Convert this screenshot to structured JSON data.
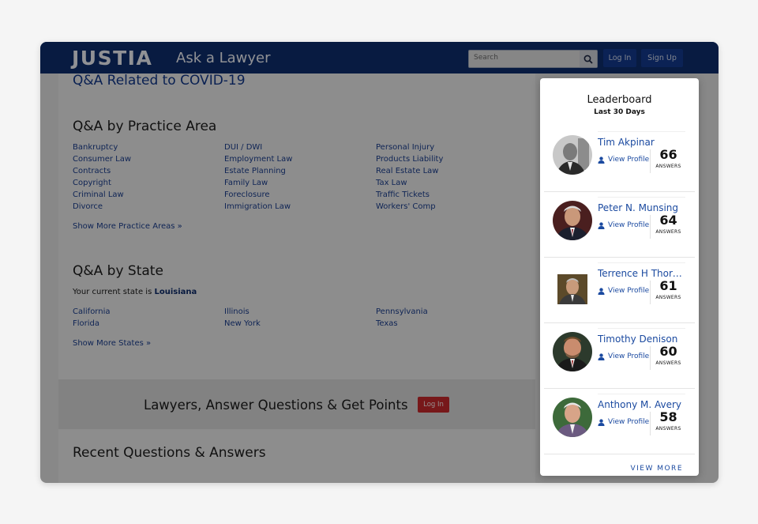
{
  "header": {
    "logo": "JUSTIA",
    "tagline": "Ask a Lawyer",
    "search_placeholder": "Search",
    "login_label": "Log In",
    "signup_label": "Sign Up"
  },
  "covid_link": "Q&A Related to COVID-19",
  "practice": {
    "heading": "Q&A by Practice Area",
    "col1": [
      "Bankruptcy",
      "Consumer Law",
      "Contracts",
      "Copyright",
      "Criminal Law",
      "Divorce"
    ],
    "col2": [
      "DUI / DWI",
      "Employment Law",
      "Estate Planning",
      "Family Law",
      "Foreclosure",
      "Immigration Law"
    ],
    "col3": [
      "Personal Injury",
      "Products Liability",
      "Real Estate Law",
      "Tax Law",
      "Traffic Tickets",
      "Workers' Comp"
    ],
    "show_more": "Show More Practice Areas »"
  },
  "state": {
    "heading": "Q&A by State",
    "current_prefix": "Your current state is",
    "current_state": "Louisiana",
    "col1": [
      "California",
      "Florida"
    ],
    "col2": [
      "Illinois",
      "New York"
    ],
    "col3": [
      "Pennsylvania",
      "Texas"
    ],
    "show_more": "Show More States »"
  },
  "promo": {
    "text": "Lawyers, Answer Questions & Get Points",
    "button": "Log In"
  },
  "recent_heading": "Recent Questions & Answers",
  "leaderboard": {
    "title": "Leaderboard",
    "subtitle": "Last 30 Days",
    "view_profile": "View Profile",
    "answers_label": "ANSWERS",
    "entries": [
      {
        "name": "Tim Akpinar",
        "count": "66"
      },
      {
        "name": "Peter N. Munsing",
        "count": "64"
      },
      {
        "name": "Terrence H Thorgaard",
        "count": "61"
      },
      {
        "name": "Timothy Denison",
        "count": "60"
      },
      {
        "name": "Anthony M. Avery",
        "count": "58"
      }
    ],
    "view_more": "VIEW MORE"
  }
}
